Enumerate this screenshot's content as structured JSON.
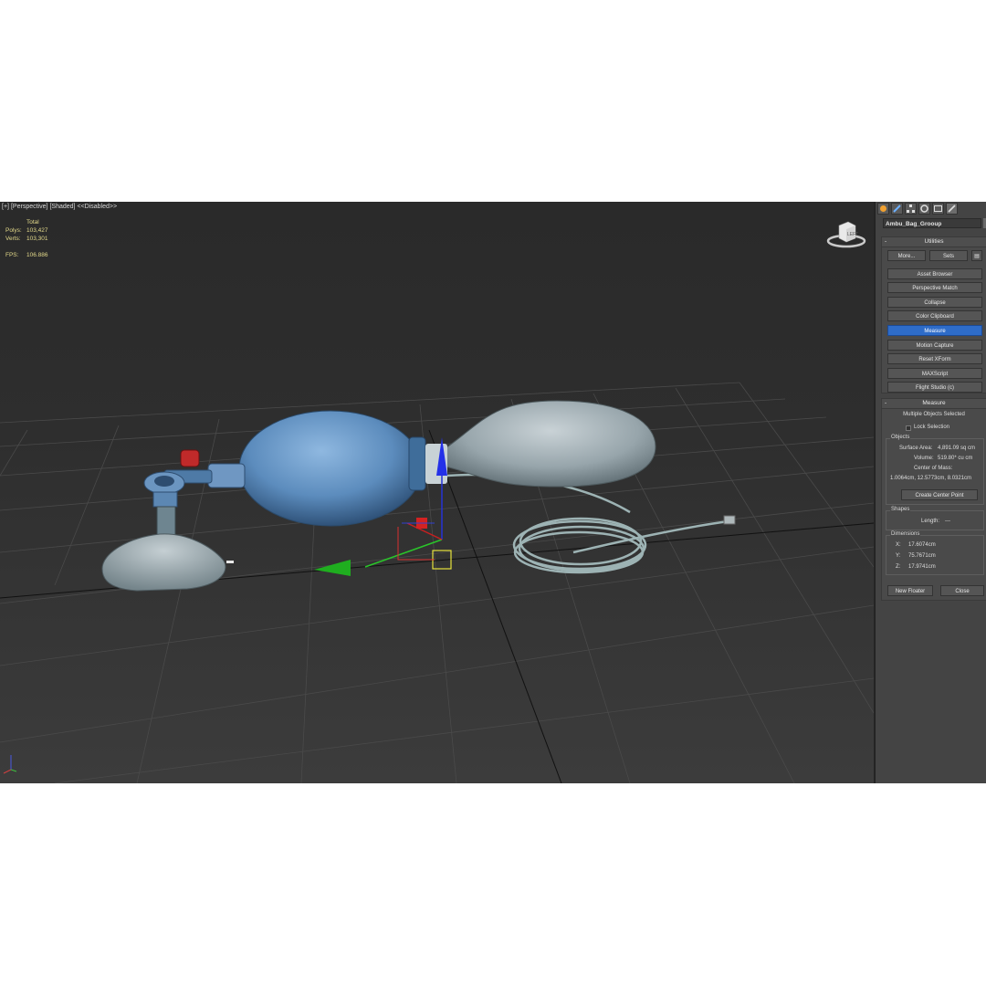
{
  "viewport": {
    "label_parts": [
      "[+]",
      "[Perspective]",
      "[Shaded]",
      "<<Disabled>>"
    ],
    "stats": {
      "total_label": "Total",
      "polys_label": "Polys:",
      "polys_value": "103,427",
      "verts_label": "Verts:",
      "verts_value": "103,301",
      "fps_label": "FPS:",
      "fps_value": "106.886"
    },
    "viewcube_label": "LEFT"
  },
  "command_panel": {
    "tabs": [
      "create-icon",
      "modify-icon",
      "hierarchy-icon",
      "motion-icon",
      "display-icon",
      "utilities-icon"
    ],
    "object_name": "Ambu_Bag_Grooup",
    "utilities": {
      "title": "Utilities",
      "more_label": "More...",
      "sets_label": "Sets",
      "items": [
        "Asset Browser",
        "Perspective Match",
        "Collapse",
        "Color Clipboard",
        "Measure",
        "Motion Capture",
        "Reset XForm",
        "MAXScript",
        "Flight Studio (c)"
      ],
      "active_item": "Measure"
    },
    "measure": {
      "title": "Measure",
      "selection_text": "Multiple Objects Selected",
      "lock_selection_label": "Lock Selection",
      "objects_title": "Objects",
      "surface_area_label": "Surface Area:",
      "surface_area_value": "4,891.09 sq cm",
      "volume_label": "Volume:",
      "volume_value": "519.80* cu cm",
      "center_of_mass_label": "Center of Mass:",
      "center_of_mass_value": "1.0064cm, 12.5773cm, 8.0321cm",
      "create_center_point_label": "Create Center Point",
      "shapes_title": "Shapes",
      "length_label": "Length:",
      "length_value": "---",
      "dimensions_title": "Dimensions",
      "x_label": "X:",
      "x_value": "17.6074cm",
      "y_label": "Y:",
      "y_value": "75.7671cm",
      "z_label": "Z:",
      "z_value": "17.9741cm",
      "new_floater_label": "New Floater",
      "close_label": "Close"
    }
  }
}
